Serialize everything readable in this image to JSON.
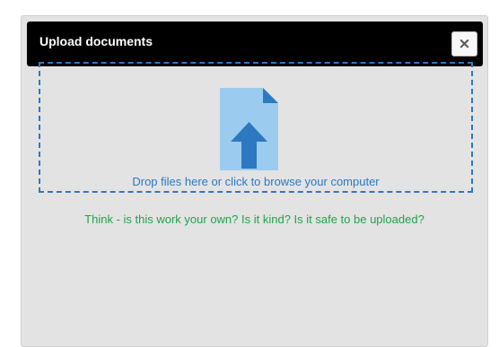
{
  "dialog": {
    "title": "Upload documents",
    "close_label": "×",
    "close_icon": "close-icon"
  },
  "dropzone": {
    "icon": "file-upload-icon",
    "text": "Drop files here or click to browse your computer"
  },
  "warning": {
    "text": "Think - is this work your own? Is it kind? Is it safe to be uploaded?"
  },
  "colors": {
    "accent": "#2c79c1",
    "warning": "#22a24a",
    "header": "#000000",
    "panel": "#e3e3e3",
    "icon_light": "#9ccbf0"
  }
}
